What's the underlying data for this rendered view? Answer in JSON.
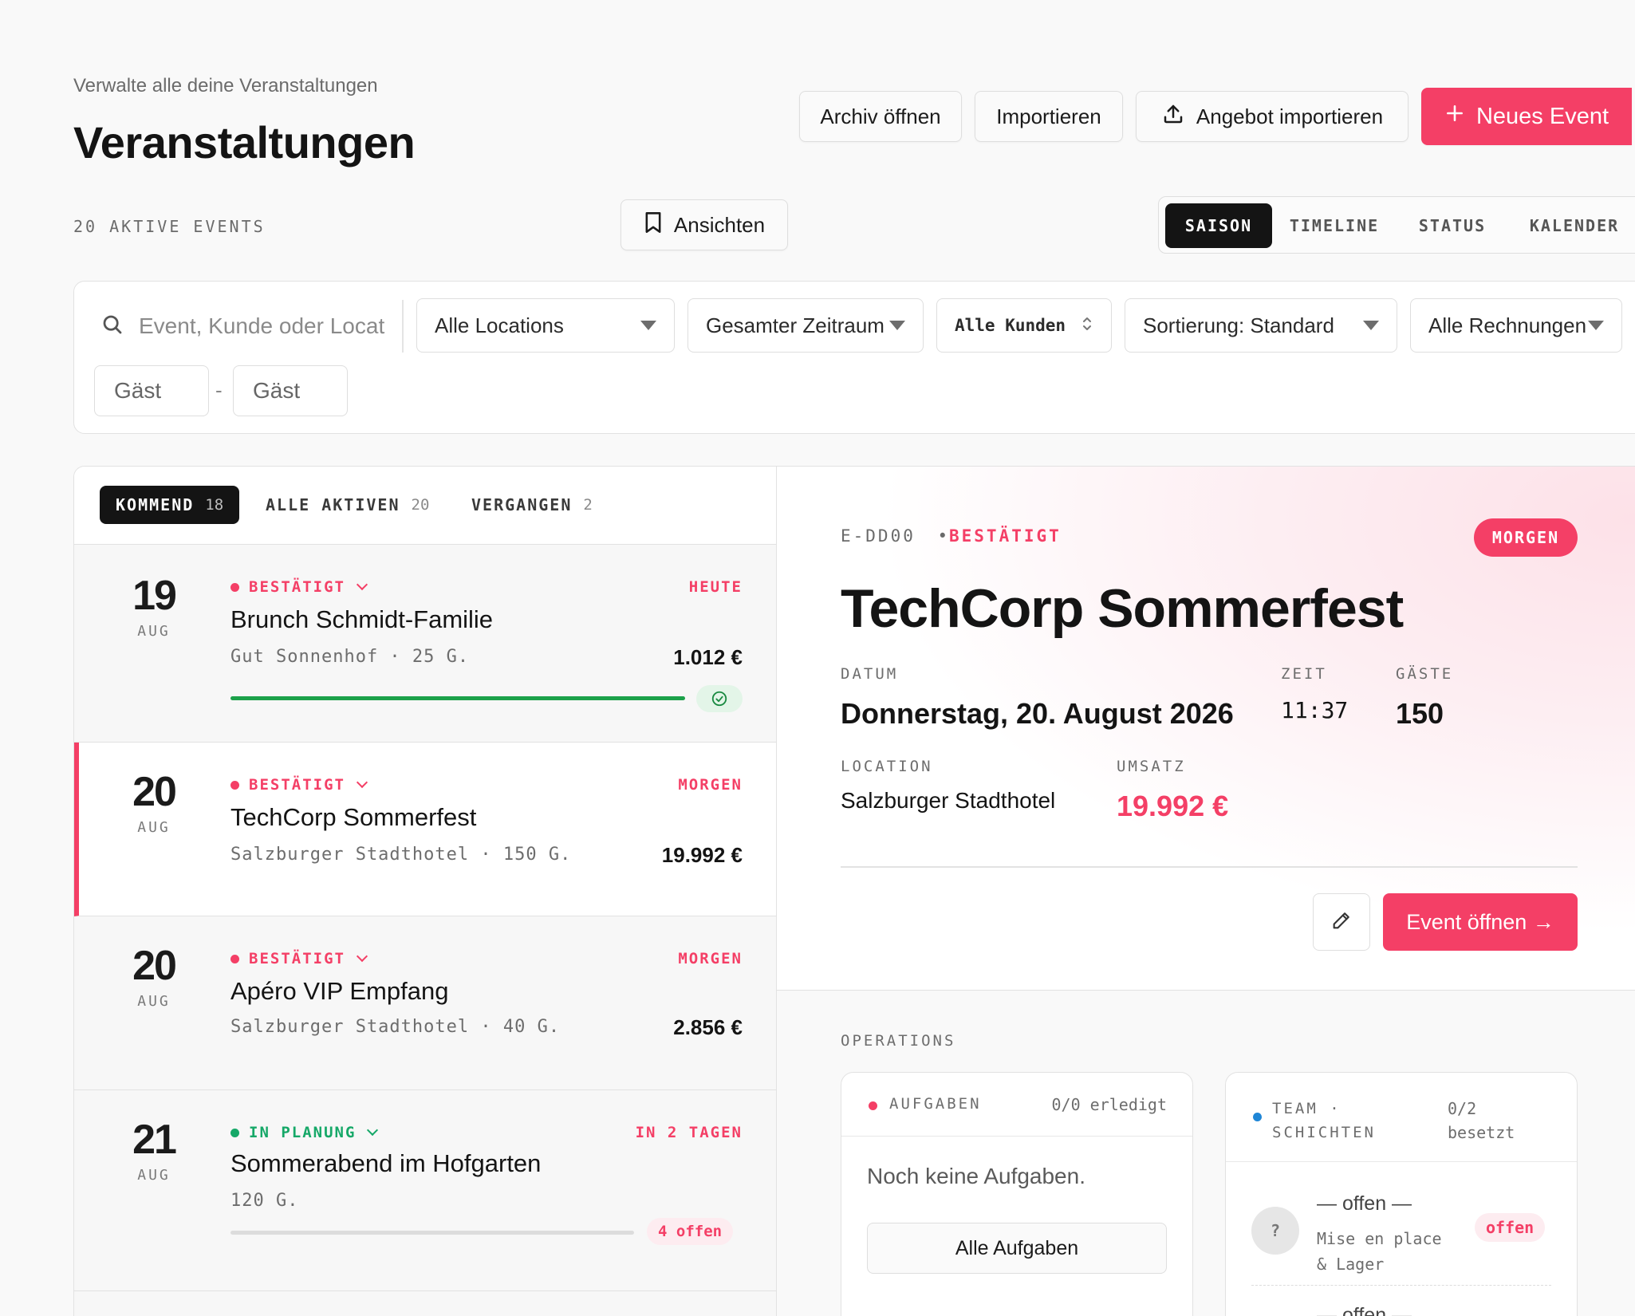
{
  "header": {
    "subtitle": "Verwalte alle deine Veranstaltungen",
    "title": "Veranstaltungen",
    "archive_label": "Archiv öffnen",
    "import_label": "Importieren",
    "import_offer_label": "Angebot importieren",
    "new_event_label": "Neues Event",
    "active_count": "20 AKTIVE EVENTS",
    "views_label": "Ansichten"
  },
  "view_switch": [
    "SAISON",
    "TIMELINE",
    "STATUS",
    "KALENDER"
  ],
  "filters": {
    "search_placeholder": "Event, Kunde oder Location",
    "locations": "Alle Locations",
    "period": "Gesamter Zeitraum",
    "customers": "Alle Kunden",
    "sort": "Sortierung: Standard",
    "invoices": "Alle Rechnungen",
    "guests_min_placeholder": "Gäst",
    "guests_max_placeholder": "Gäst",
    "guests_separator": "-"
  },
  "list_tabs": [
    {
      "label": "KOMMEND",
      "count": "18"
    },
    {
      "label": "ALLE AKTIVEN",
      "count": "20"
    },
    {
      "label": "VERGANGEN",
      "count": "2"
    }
  ],
  "events": [
    {
      "day": "19",
      "month": "AUG",
      "status": "BESTÄTIGT",
      "when": "HEUTE",
      "title": "Brunch Schmidt-Familie",
      "meta": "Gut Sonnenhof · 25 G.",
      "amount": "1.012 €",
      "progress": 1.0
    },
    {
      "day": "20",
      "month": "AUG",
      "status": "BESTÄTIGT",
      "when": "MORGEN",
      "title": "TechCorp Sommerfest",
      "meta": "Salzburger Stadthotel · 150 G.",
      "amount": "19.992 €"
    },
    {
      "day": "20",
      "month": "AUG",
      "status": "BESTÄTIGT",
      "when": "MORGEN",
      "title": "Apéro VIP Empfang",
      "meta": "Salzburger Stadthotel · 40 G.",
      "amount": "2.856 €"
    },
    {
      "day": "21",
      "month": "AUG",
      "status": "IN PLANUNG",
      "when": "IN 2 TAGEN",
      "title": "Sommerabend im Hofgarten",
      "meta": "120 G.",
      "open_tasks": "4 offen",
      "progress": 0.0
    }
  ],
  "detail": {
    "code": "E-DD00",
    "separator": "•",
    "status": "BESTÄTIGT",
    "badge": "MORGEN",
    "title": "TechCorp Sommerfest",
    "date_label": "DATUM",
    "date": "Donnerstag, 20. August 2026",
    "time_label": "ZEIT",
    "time": "11:37",
    "guests_label": "GÄSTE",
    "guests": "150",
    "location_label": "LOCATION",
    "location": "Salzburger Stadthotel",
    "revenue_label": "UMSATZ",
    "revenue": "19.992 €",
    "open_label": "Event öffnen →"
  },
  "operations": {
    "label": "OPERATIONS",
    "tasks": {
      "label": "AUFGABEN",
      "progress": "0/0 erledigt",
      "empty": "Noch keine Aufgaben.",
      "all_label": "Alle Aufgaben"
    },
    "team": {
      "label_1": "TEAM ·",
      "label_2": "SCHICHTEN",
      "progress_1": "0/2",
      "progress_2": "besetzt",
      "shift": {
        "avatar": "?",
        "name": "— offen —",
        "role_1": "Mise en place",
        "role_2": "& Lager",
        "badge": "offen"
      },
      "next_name": "— offen —"
    }
  },
  "colors": {
    "accent": "#f43f66",
    "success": "#1ca14a",
    "planning": "#16a868",
    "team_dot": "#1f86d6",
    "dark": "#141414"
  }
}
